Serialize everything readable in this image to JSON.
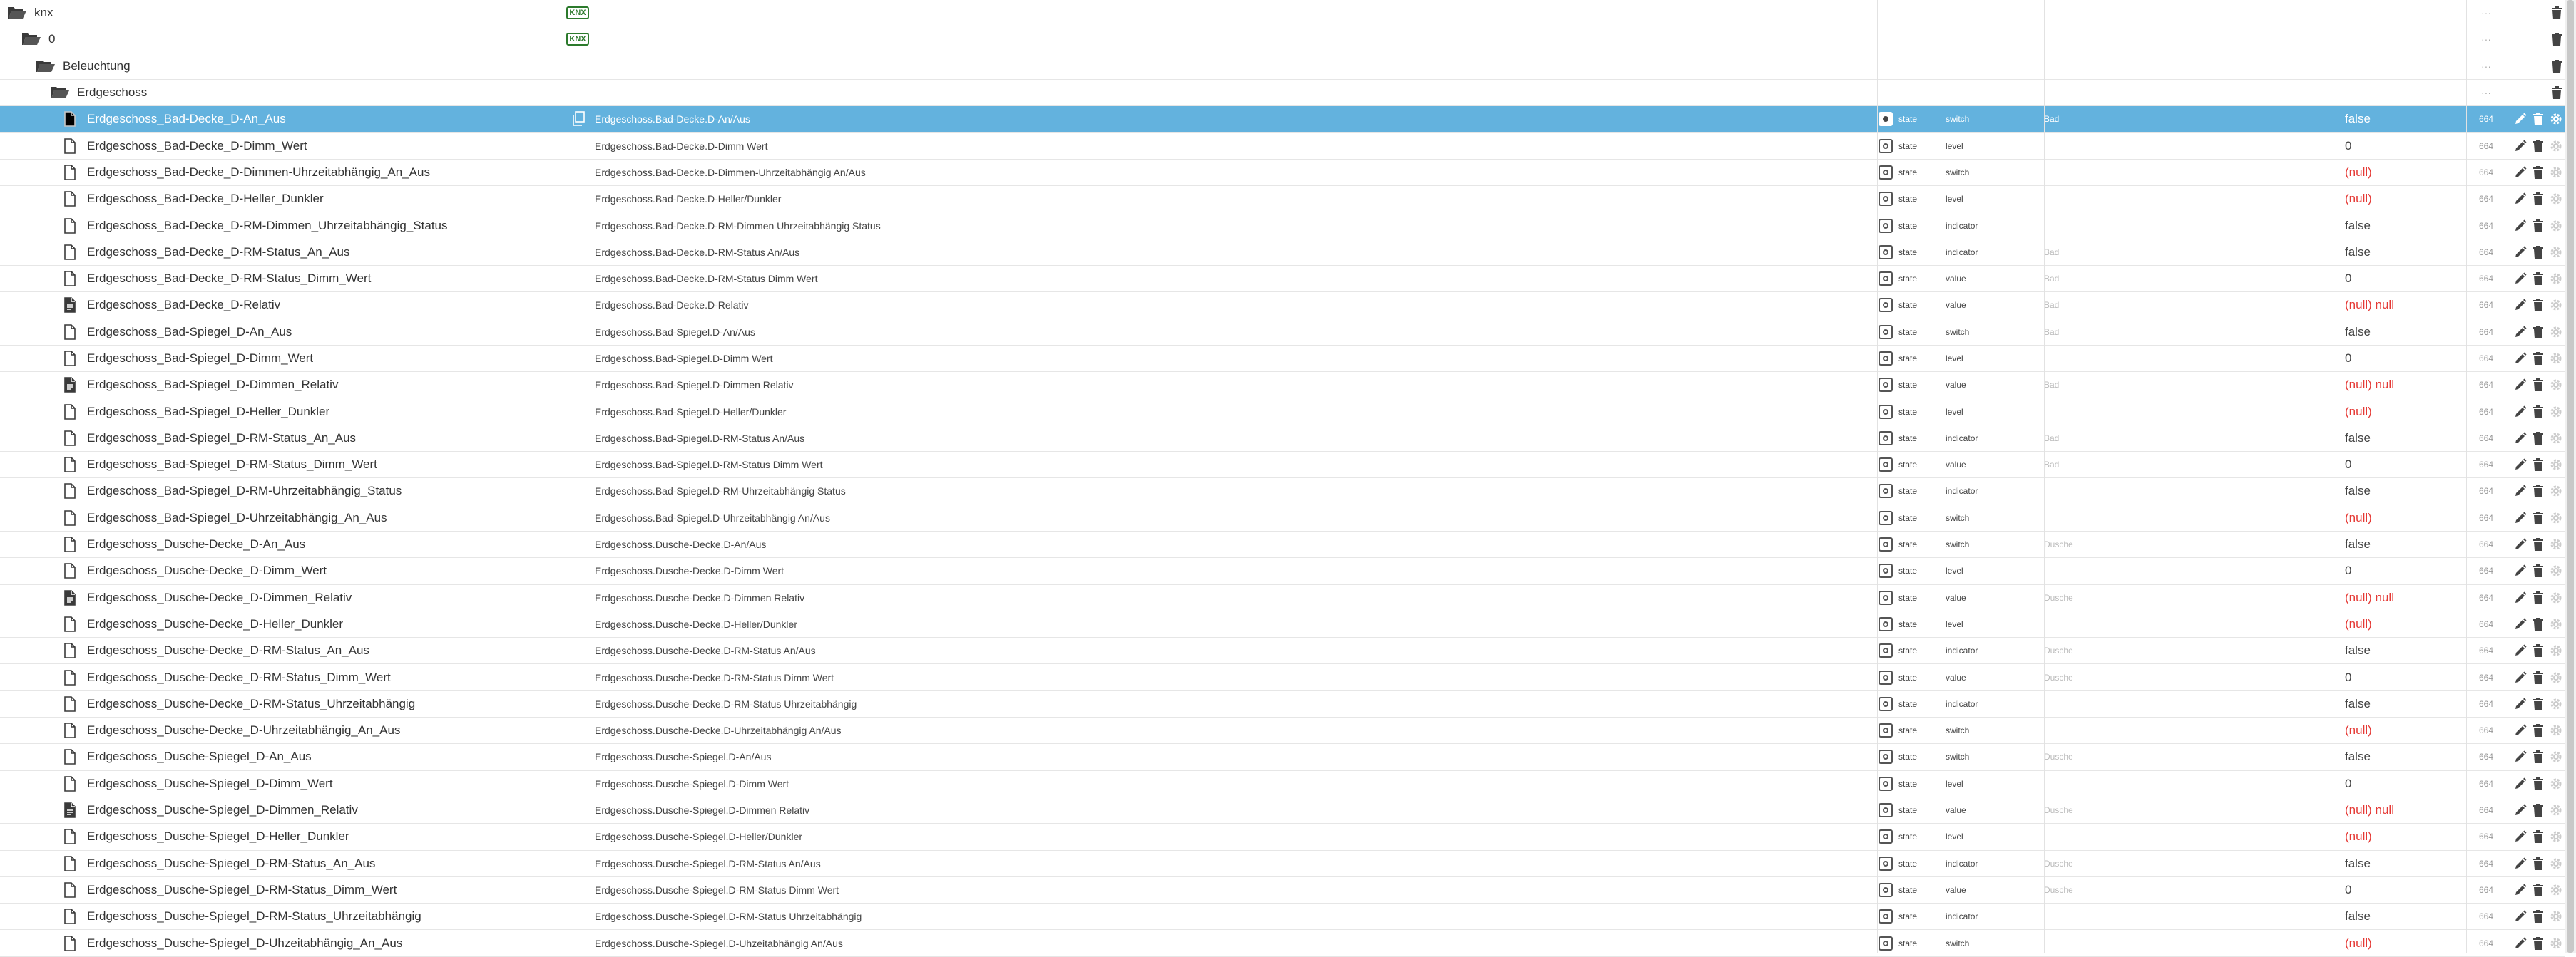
{
  "icons": {
    "folder_open": "folder-open-icon",
    "file": "file-icon",
    "file_text": "file-text-icon",
    "copy": "copy-icon",
    "edit": "pencil-icon",
    "delete": "trash-icon",
    "settings": "gear-icon",
    "knx": "knx-logo"
  },
  "colors": {
    "selected_row": "#63b2de",
    "null_value": "#e53935"
  },
  "folders": [
    {
      "name": "knx",
      "level": 0,
      "logo_text": "KNX"
    },
    {
      "name": "0",
      "level": 1,
      "logo_text": "KNX"
    },
    {
      "name": "Beleuchtung",
      "level": 2
    },
    {
      "name": "Erdgeschoss",
      "level": 3
    }
  ],
  "folder_dots": "···",
  "states": [
    {
      "id": "Erdgeschoss_Bad-Decke_D-An_Aus",
      "icon": "file",
      "name": "Erdgeschoss.Bad-Decke.D-An/Aus",
      "type": "state",
      "role": "switch",
      "room": "Bad",
      "value": "false",
      "ack": "664",
      "selected": true
    },
    {
      "id": "Erdgeschoss_Bad-Decke_D-Dimm_Wert",
      "icon": "file",
      "name": "Erdgeschoss.Bad-Decke.D-Dimm Wert",
      "type": "state",
      "role": "level",
      "room": "",
      "value": "0",
      "ack": "664"
    },
    {
      "id": "Erdgeschoss_Bad-Decke_D-Dimmen-Uhrzeitabhängig_An_Aus",
      "icon": "file",
      "name": "Erdgeschoss.Bad-Decke.D-Dimmen-Uhrzeitabhängig An/Aus",
      "type": "state",
      "role": "switch",
      "room": "",
      "value": "(null)",
      "ack": "664",
      "is_null": true
    },
    {
      "id": "Erdgeschoss_Bad-Decke_D-Heller_Dunkler",
      "icon": "file",
      "name": "Erdgeschoss.Bad-Decke.D-Heller/Dunkler",
      "type": "state",
      "role": "level",
      "room": "",
      "value": "(null)",
      "ack": "664",
      "is_null": true
    },
    {
      "id": "Erdgeschoss_Bad-Decke_D-RM-Dimmen_Uhrzeitabhängig_Status",
      "icon": "file",
      "name": "Erdgeschoss.Bad-Decke.D-RM-Dimmen Uhrzeitabhängig Status",
      "type": "state",
      "role": "indicator",
      "room": "",
      "value": "false",
      "ack": "664"
    },
    {
      "id": "Erdgeschoss_Bad-Decke_D-RM-Status_An_Aus",
      "icon": "file",
      "name": "Erdgeschoss.Bad-Decke.D-RM-Status An/Aus",
      "type": "state",
      "role": "indicator",
      "room": "Bad",
      "value": "false",
      "ack": "664"
    },
    {
      "id": "Erdgeschoss_Bad-Decke_D-RM-Status_Dimm_Wert",
      "icon": "file",
      "name": "Erdgeschoss.Bad-Decke.D-RM-Status Dimm Wert",
      "type": "state",
      "role": "value",
      "room": "Bad",
      "value": "0",
      "ack": "664"
    },
    {
      "id": "Erdgeschoss_Bad-Decke_D-Relativ",
      "icon": "file_text",
      "name": "Erdgeschoss.Bad-Decke.D-Relativ",
      "type": "state",
      "role": "value",
      "room": "Bad",
      "value": "(null) null",
      "ack": "664",
      "is_null": true
    },
    {
      "id": "Erdgeschoss_Bad-Spiegel_D-An_Aus",
      "icon": "file",
      "name": "Erdgeschoss.Bad-Spiegel.D-An/Aus",
      "type": "state",
      "role": "switch",
      "room": "Bad",
      "value": "false",
      "ack": "664"
    },
    {
      "id": "Erdgeschoss_Bad-Spiegel_D-Dimm_Wert",
      "icon": "file",
      "name": "Erdgeschoss.Bad-Spiegel.D-Dimm Wert",
      "type": "state",
      "role": "level",
      "room": "",
      "value": "0",
      "ack": "664"
    },
    {
      "id": "Erdgeschoss_Bad-Spiegel_D-Dimmen_Relativ",
      "icon": "file_text",
      "name": "Erdgeschoss.Bad-Spiegel.D-Dimmen Relativ",
      "type": "state",
      "role": "value",
      "room": "Bad",
      "value": "(null) null",
      "ack": "664",
      "is_null": true
    },
    {
      "id": "Erdgeschoss_Bad-Spiegel_D-Heller_Dunkler",
      "icon": "file",
      "name": "Erdgeschoss.Bad-Spiegel.D-Heller/Dunkler",
      "type": "state",
      "role": "level",
      "room": "",
      "value": "(null)",
      "ack": "664",
      "is_null": true
    },
    {
      "id": "Erdgeschoss_Bad-Spiegel_D-RM-Status_An_Aus",
      "icon": "file",
      "name": "Erdgeschoss.Bad-Spiegel.D-RM-Status An/Aus",
      "type": "state",
      "role": "indicator",
      "room": "Bad",
      "value": "false",
      "ack": "664"
    },
    {
      "id": "Erdgeschoss_Bad-Spiegel_D-RM-Status_Dimm_Wert",
      "icon": "file",
      "name": "Erdgeschoss.Bad-Spiegel.D-RM-Status Dimm Wert",
      "type": "state",
      "role": "value",
      "room": "Bad",
      "value": "0",
      "ack": "664"
    },
    {
      "id": "Erdgeschoss_Bad-Spiegel_D-RM-Uhrzeitabhängig_Status",
      "icon": "file",
      "name": "Erdgeschoss.Bad-Spiegel.D-RM-Uhrzeitabhängig Status",
      "type": "state",
      "role": "indicator",
      "room": "",
      "value": "false",
      "ack": "664"
    },
    {
      "id": "Erdgeschoss_Bad-Spiegel_D-Uhrzeitabhängig_An_Aus",
      "icon": "file",
      "name": "Erdgeschoss.Bad-Spiegel.D-Uhrzeitabhängig An/Aus",
      "type": "state",
      "role": "switch",
      "room": "",
      "value": "(null)",
      "ack": "664",
      "is_null": true
    },
    {
      "id": "Erdgeschoss_Dusche-Decke_D-An_Aus",
      "icon": "file",
      "name": "Erdgeschoss.Dusche-Decke.D-An/Aus",
      "type": "state",
      "role": "switch",
      "room": "Dusche",
      "value": "false",
      "ack": "664"
    },
    {
      "id": "Erdgeschoss_Dusche-Decke_D-Dimm_Wert",
      "icon": "file",
      "name": "Erdgeschoss.Dusche-Decke.D-Dimm Wert",
      "type": "state",
      "role": "level",
      "room": "",
      "value": "0",
      "ack": "664"
    },
    {
      "id": "Erdgeschoss_Dusche-Decke_D-Dimmen_Relativ",
      "icon": "file_text",
      "name": "Erdgeschoss.Dusche-Decke.D-Dimmen Relativ",
      "type": "state",
      "role": "value",
      "room": "Dusche",
      "value": "(null) null",
      "ack": "664",
      "is_null": true
    },
    {
      "id": "Erdgeschoss_Dusche-Decke_D-Heller_Dunkler",
      "icon": "file",
      "name": "Erdgeschoss.Dusche-Decke.D-Heller/Dunkler",
      "type": "state",
      "role": "level",
      "room": "",
      "value": "(null)",
      "ack": "664",
      "is_null": true
    },
    {
      "id": "Erdgeschoss_Dusche-Decke_D-RM-Status_An_Aus",
      "icon": "file",
      "name": "Erdgeschoss.Dusche-Decke.D-RM-Status An/Aus",
      "type": "state",
      "role": "indicator",
      "room": "Dusche",
      "value": "false",
      "ack": "664"
    },
    {
      "id": "Erdgeschoss_Dusche-Decke_D-RM-Status_Dimm_Wert",
      "icon": "file",
      "name": "Erdgeschoss.Dusche-Decke.D-RM-Status Dimm Wert",
      "type": "state",
      "role": "value",
      "room": "Dusche",
      "value": "0",
      "ack": "664"
    },
    {
      "id": "Erdgeschoss_Dusche-Decke_D-RM-Status_Uhrzeitabhängig",
      "icon": "file",
      "name": "Erdgeschoss.Dusche-Decke.D-RM-Status Uhrzeitabhängig",
      "type": "state",
      "role": "indicator",
      "room": "",
      "value": "false",
      "ack": "664"
    },
    {
      "id": "Erdgeschoss_Dusche-Decke_D-Uhrzeitabhängig_An_Aus",
      "icon": "file",
      "name": "Erdgeschoss.Dusche-Decke.D-Uhrzeitabhängig An/Aus",
      "type": "state",
      "role": "switch",
      "room": "",
      "value": "(null)",
      "ack": "664",
      "is_null": true
    },
    {
      "id": "Erdgeschoss_Dusche-Spiegel_D-An_Aus",
      "icon": "file",
      "name": "Erdgeschoss.Dusche-Spiegel.D-An/Aus",
      "type": "state",
      "role": "switch",
      "room": "Dusche",
      "value": "false",
      "ack": "664"
    },
    {
      "id": "Erdgeschoss_Dusche-Spiegel_D-Dimm_Wert",
      "icon": "file",
      "name": "Erdgeschoss.Dusche-Spiegel.D-Dimm Wert",
      "type": "state",
      "role": "level",
      "room": "",
      "value": "0",
      "ack": "664"
    },
    {
      "id": "Erdgeschoss_Dusche-Spiegel_D-Dimmen_Relativ",
      "icon": "file_text",
      "name": "Erdgeschoss.Dusche-Spiegel.D-Dimmen Relativ",
      "type": "state",
      "role": "value",
      "room": "Dusche",
      "value": "(null) null",
      "ack": "664",
      "is_null": true
    },
    {
      "id": "Erdgeschoss_Dusche-Spiegel_D-Heller_Dunkler",
      "icon": "file",
      "name": "Erdgeschoss.Dusche-Spiegel.D-Heller/Dunkler",
      "type": "state",
      "role": "level",
      "room": "",
      "value": "(null)",
      "ack": "664",
      "is_null": true
    },
    {
      "id": "Erdgeschoss_Dusche-Spiegel_D-RM-Status_An_Aus",
      "icon": "file",
      "name": "Erdgeschoss.Dusche-Spiegel.D-RM-Status An/Aus",
      "type": "state",
      "role": "indicator",
      "room": "Dusche",
      "value": "false",
      "ack": "664"
    },
    {
      "id": "Erdgeschoss_Dusche-Spiegel_D-RM-Status_Dimm_Wert",
      "icon": "file",
      "name": "Erdgeschoss.Dusche-Spiegel.D-RM-Status Dimm Wert",
      "type": "state",
      "role": "value",
      "room": "Dusche",
      "value": "0",
      "ack": "664"
    },
    {
      "id": "Erdgeschoss_Dusche-Spiegel_D-RM-Status_Uhrzeitabhängig",
      "icon": "file",
      "name": "Erdgeschoss.Dusche-Spiegel.D-RM-Status Uhrzeitabhängig",
      "type": "state",
      "role": "indicator",
      "room": "",
      "value": "false",
      "ack": "664"
    },
    {
      "id": "Erdgeschoss_Dusche-Spiegel_D-Uhzeitabhängig_An_Aus",
      "icon": "file",
      "name": "Erdgeschoss.Dusche-Spiegel.D-Uhzeitabhängig An/Aus",
      "type": "state",
      "role": "switch",
      "room": "",
      "value": "(null)",
      "ack": "664",
      "is_null": true
    }
  ]
}
